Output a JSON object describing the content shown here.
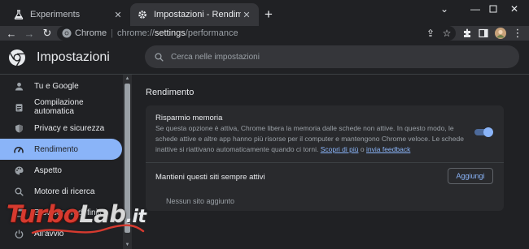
{
  "tabs": [
    {
      "title": "Experiments",
      "icon": "flask-icon",
      "active": false
    },
    {
      "title": "Impostazioni - Rendimento",
      "icon": "gear-icon",
      "active": true
    }
  ],
  "toolbar": {
    "site_label": "Chrome",
    "url_host": "chrome://",
    "url_path": "settings",
    "url_rest": "/performance"
  },
  "header": {
    "title": "Impostazioni",
    "search_placeholder": "Cerca nelle impostazioni"
  },
  "sidebar": {
    "items": [
      {
        "label": "Tu e Google",
        "icon": "person-icon",
        "active": false
      },
      {
        "label": "Compilazione automatica",
        "icon": "clipboard-icon",
        "active": false
      },
      {
        "label": "Privacy e sicurezza",
        "icon": "shield-icon",
        "active": false
      },
      {
        "label": "Rendimento",
        "icon": "speedometer-icon",
        "active": true
      },
      {
        "label": "Aspetto",
        "icon": "palette-icon",
        "active": false
      },
      {
        "label": "Motore di ricerca",
        "icon": "search-icon",
        "active": false
      },
      {
        "label": "Browser predefinito",
        "icon": "browser-icon",
        "active": false
      },
      {
        "label": "All'avvio",
        "icon": "power-icon",
        "active": false
      }
    ]
  },
  "main": {
    "section_title": "Rendimento",
    "memory_saver": {
      "title": "Risparmio memoria",
      "description": "Se questa opzione è attiva, Chrome libera la memoria dalle schede non attive. In questo modo, le schede attive e altre app hanno più risorse per il computer e mantengono Chrome veloce. Le schede inattive si riattivano automaticamente quando ci torni.",
      "link_learn_more": "Scopri di più",
      "link_separator": "o",
      "link_feedback": "invia feedback",
      "enabled": true
    },
    "always_active": {
      "title": "Mantieni questi siti sempre attivi",
      "add_button": "Aggiungi",
      "empty_text": "Nessun sito aggiunto"
    }
  },
  "watermark": {
    "part1": "Turbo",
    "part2": "Lab",
    "part3": ".it"
  },
  "colors": {
    "accent": "#8ab4f8",
    "background": "#202124",
    "card": "#292a2d",
    "watermark_red": "#d63a2f"
  }
}
